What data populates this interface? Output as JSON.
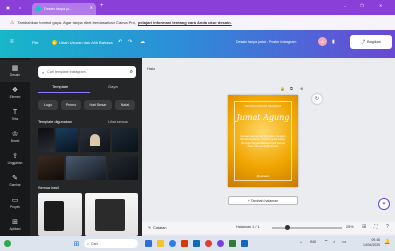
{
  "browser": {
    "tab_title": "Desain tanpa ju...",
    "new_tab": "+",
    "minimize": "–",
    "maximize": "❐",
    "close": "✕"
  },
  "notice": {
    "text": "Tambahkan tombol gaya. Agar tanpa ribet berdasarkan Canva Pro,",
    "link": "pelajari informasi tentang cara Anda ukur desain."
  },
  "topbar": {
    "file": "File",
    "resize": "Ubah Ukuran dan Alih Bahasa",
    "title": "Desain tanpa judul - Poster Instagram",
    "share": "Bagikan"
  },
  "rail": [
    "Desain",
    "Elemen",
    "Teks",
    "Brand",
    "Unggahan",
    "Gambar",
    "Proyek",
    "Aplikasi"
  ],
  "panel": {
    "search_placeholder": "Cari template Instagram",
    "tabs": [
      "Template",
      "Gaya"
    ],
    "chips": [
      "Logo",
      "Promo",
      "Hari Besar",
      "Natal"
    ],
    "section1": "Template digunakan",
    "see_all": "Lihat semua",
    "section2": "Semua hasil"
  },
  "editor": {
    "title": "Halo",
    "card": {
      "top_line": "MENGUCAPKAN SELAMAT",
      "heading": "Jumat Agung",
      "body": "Dengan semua hati bersyukur, Dengan Penuh Keyakinan Kita Bersama Tuhan, Semoga Menjadi Berkat Untuk Semua dalam Damai Kasih Kristus",
      "footer": "@namamu"
    },
    "add_page": "+ Tambah halaman",
    "notes": "Catatan",
    "page_info": "Halaman 1 / 1",
    "zoom": "25%"
  },
  "taskbar": {
    "search": "Cari",
    "lang": "IND",
    "time": "09.46",
    "date": "14/04/2025"
  },
  "colors": {
    "tabbar": "#8a3fd8",
    "canva_gradient_start": "#17b6c9",
    "canva_gradient_end": "#6a47d6",
    "card_gold": "#f0a500"
  }
}
